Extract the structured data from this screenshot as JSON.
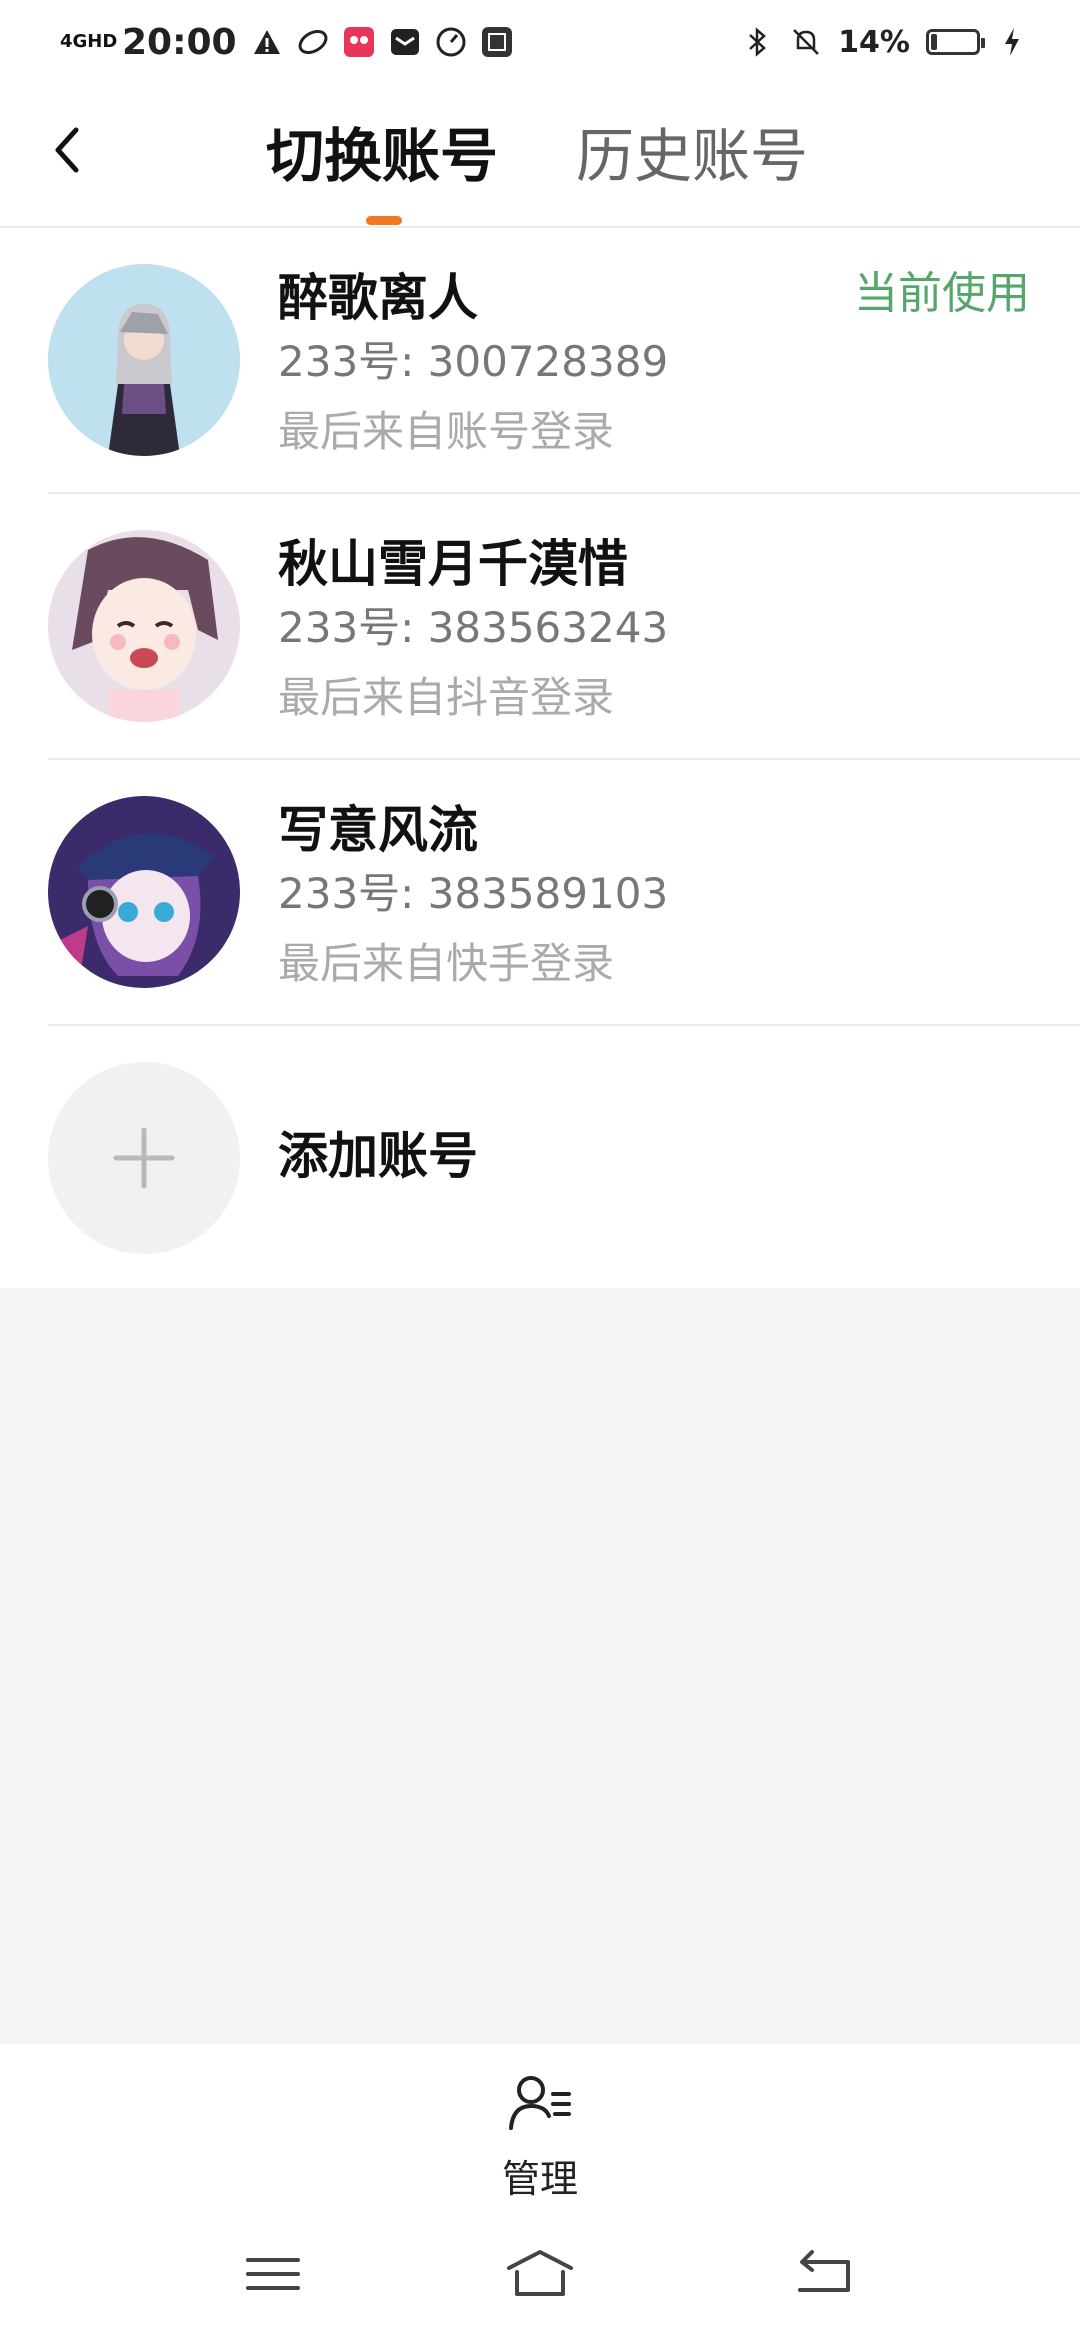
{
  "status_bar": {
    "network": "4GHD",
    "time": "20:00",
    "battery_percent": "14%",
    "battery_level": 0.14
  },
  "header": {
    "tabs": [
      {
        "label": "切换账号",
        "active": true
      },
      {
        "label": "历史账号",
        "active": false
      }
    ],
    "accent_color": "#f07a22"
  },
  "accounts": [
    {
      "name": "醉歌离人",
      "uid": "233号: 300728389",
      "source": "最后来自账号登录",
      "badge": "当前使用"
    },
    {
      "name": "秋山雪月千漠惜",
      "uid": "233号: 383563243",
      "source": "最后来自抖音登录"
    },
    {
      "name": "写意风流",
      "uid": "233号: 383589103",
      "source": "最后来自快手登录"
    }
  ],
  "add_account": {
    "label": "添加账号"
  },
  "bottom": {
    "manage_label": "管理"
  },
  "colors": {
    "current_badge": "#55a769"
  }
}
